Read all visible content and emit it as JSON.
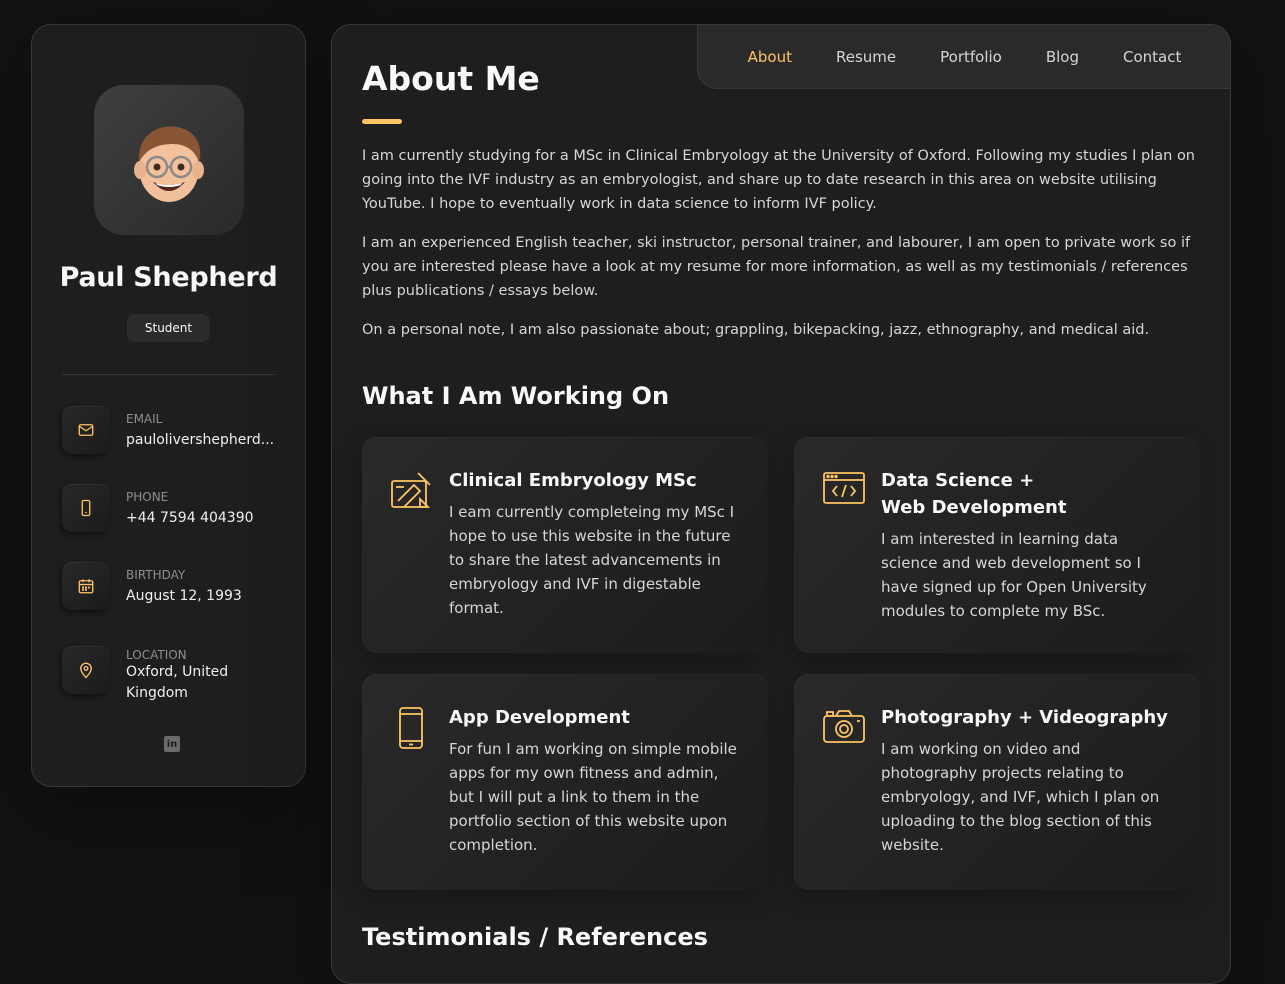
{
  "profile": {
    "name": "Paul Shepherd",
    "title": "Student"
  },
  "contacts": [
    {
      "label": "Email",
      "value": "paulolivershepherd..."
    },
    {
      "label": "Phone",
      "value": "+44 7594 404390"
    },
    {
      "label": "Birthday",
      "value": "August 12, 1993"
    },
    {
      "label": "Location",
      "value": "Oxford, United Kingdom"
    }
  ],
  "social": {
    "linkedin_glyph": "in"
  },
  "nav": {
    "items": [
      "About",
      "Resume",
      "Portfolio",
      "Blog",
      "Contact"
    ],
    "active": "About"
  },
  "about": {
    "heading": "About Me",
    "paragraphs": [
      "I am currently studying for a MSc in Clinical Embryology at the University of Oxford. Following my studies I plan on going into the IVF industry as an embryologist, and share up to date research in this area on website utilising YouTube. I hope to eventually work in data science to inform IVF policy.",
      "I am an experienced English teacher, ski instructor, personal trainer, and labourer, I am open to private work so if you are interested please have a look at my resume for more information, as well as my testimonials / references plus publications / essays below.",
      "On a personal note, I am also passionate about; grappling, bikepacking, jazz, ethnography, and medical aid."
    ]
  },
  "working_on": {
    "heading": "What I Am Working On",
    "services": [
      {
        "title": "Clinical Embryology MSc",
        "text": "I eam currently completeing my MSc I hope to use this website in the future to share the latest advancements in embryology and IVF in digestable format.",
        "icon": "design-icon"
      },
      {
        "title": "Data Science + Web Development",
        "text": "I am interested in learning data science and web development so I have signed up for Open University modules to complete my BSc.",
        "icon": "code-window-icon"
      },
      {
        "title": "App Development",
        "text": "For fun I am working on simple mobile apps for my own fitness and admin, but I will put a link to them in the portfolio section of this website upon completion.",
        "icon": "mobile-icon"
      },
      {
        "title": "Photography + Videography",
        "text": "I am working on video and photography projects relating to embryology, and IVF, which I plan on uploading to the blog section of this website.",
        "icon": "camera-icon"
      }
    ]
  },
  "testimonials": {
    "heading": "Testimonials / References"
  },
  "colors": {
    "accent": "#ffc561",
    "background": "#121212",
    "card": "#1e1e1f"
  }
}
